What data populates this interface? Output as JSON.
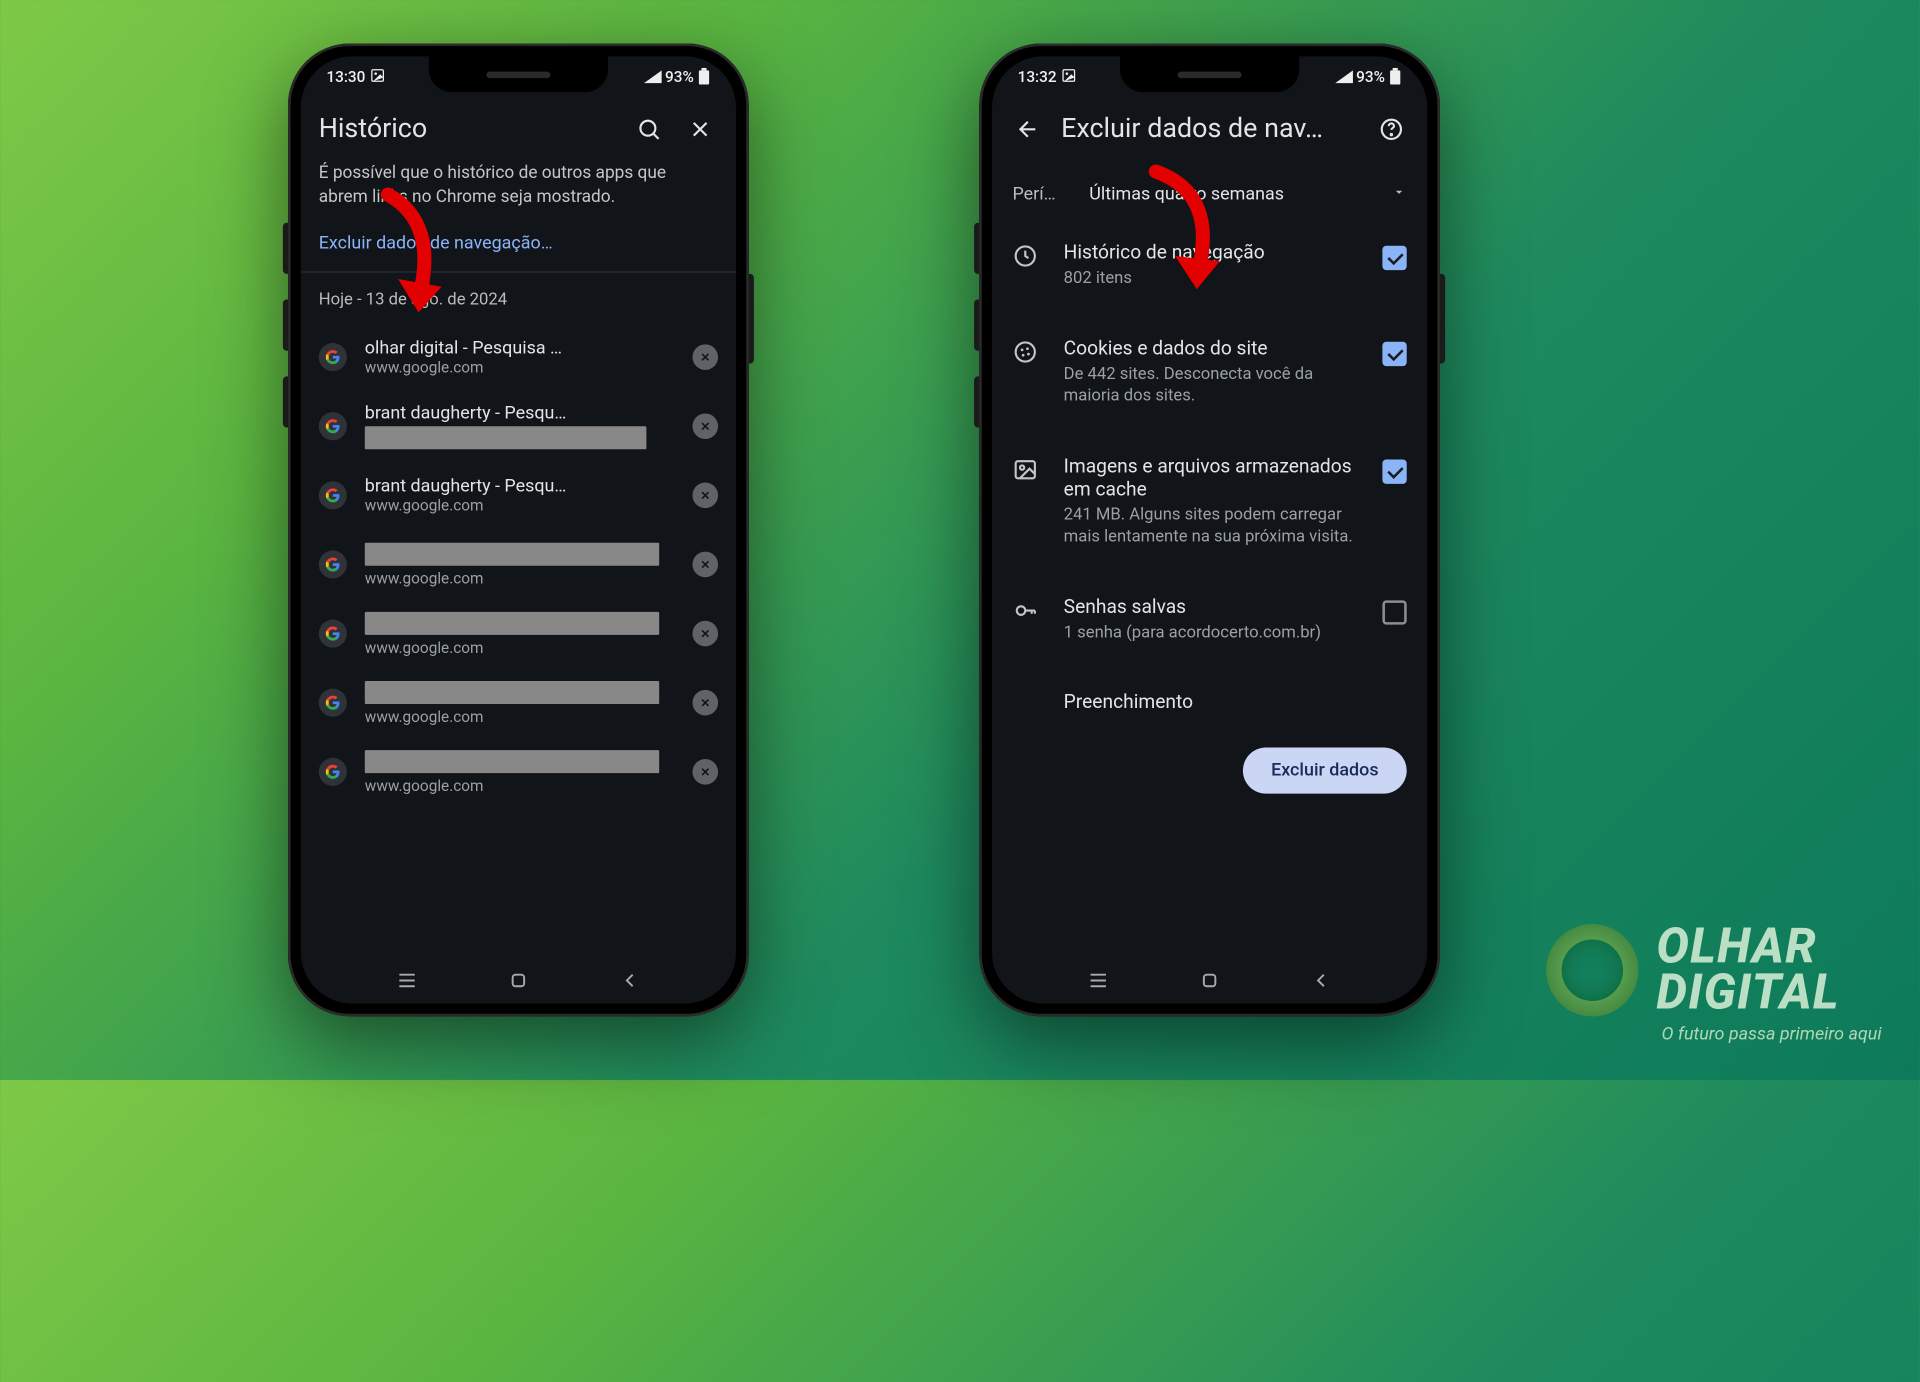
{
  "phones": {
    "left": {
      "status": {
        "time": "13:30",
        "battery": "93%"
      },
      "title": "Histórico",
      "notice": "É possível que o histórico de outros apps que abrem links no Chrome seja mostrado.",
      "clear_link": "Excluir dados de navegação…",
      "date_header": "Hoje - 13 de ago. de 2024",
      "history": [
        {
          "title": "olhar digital - Pesquisa …",
          "url": "www.google.com",
          "redactedTitle": false,
          "redactedUrl": false
        },
        {
          "title": "brant daugherty - Pesqu…",
          "url": "",
          "redactedTitle": false,
          "redactedUrl": true
        },
        {
          "title": "brant daugherty - Pesqu…",
          "url": "www.google.com",
          "redactedTitle": false,
          "redactedUrl": false
        },
        {
          "title": "",
          "url": "www.google.com",
          "redactedTitle": true,
          "redactedUrl": false
        },
        {
          "title": "",
          "url": "www.google.com",
          "redactedTitle": true,
          "redactedUrl": false
        },
        {
          "title": "",
          "url": "www.google.com",
          "redactedTitle": true,
          "redactedUrl": false
        },
        {
          "title": "",
          "url": "www.google.com",
          "redactedTitle": true,
          "redactedUrl": false
        }
      ]
    },
    "right": {
      "status": {
        "time": "13:32",
        "battery": "93%"
      },
      "title": "Excluir dados de nav…",
      "period": {
        "label": "Perí…",
        "value": "Últimas quatro semanas"
      },
      "items": [
        {
          "icon": "clock",
          "title": "Histórico de navegação",
          "sub": "802 itens",
          "checked": true
        },
        {
          "icon": "cookie",
          "title": "Cookies e dados do site",
          "sub": "De 442 sites. Desconecta você da maioria dos sites.",
          "checked": true
        },
        {
          "icon": "image",
          "title": "Imagens e arquivos armazenados em cache",
          "sub": "241 MB. Alguns sites podem carregar mais lentamente na sua próxima visita.",
          "checked": true
        },
        {
          "icon": "key",
          "title": "Senhas salvas",
          "sub": "1 senha (para acordocerto.com.br)",
          "checked": false
        },
        {
          "icon": "",
          "title": "Preenchimento",
          "sub": "",
          "checked": null
        }
      ],
      "action": "Excluir dados"
    }
  },
  "watermark": {
    "line1": "OLHAR",
    "line2": "DIGITAL",
    "tag": "O futuro passa primeiro aqui"
  }
}
